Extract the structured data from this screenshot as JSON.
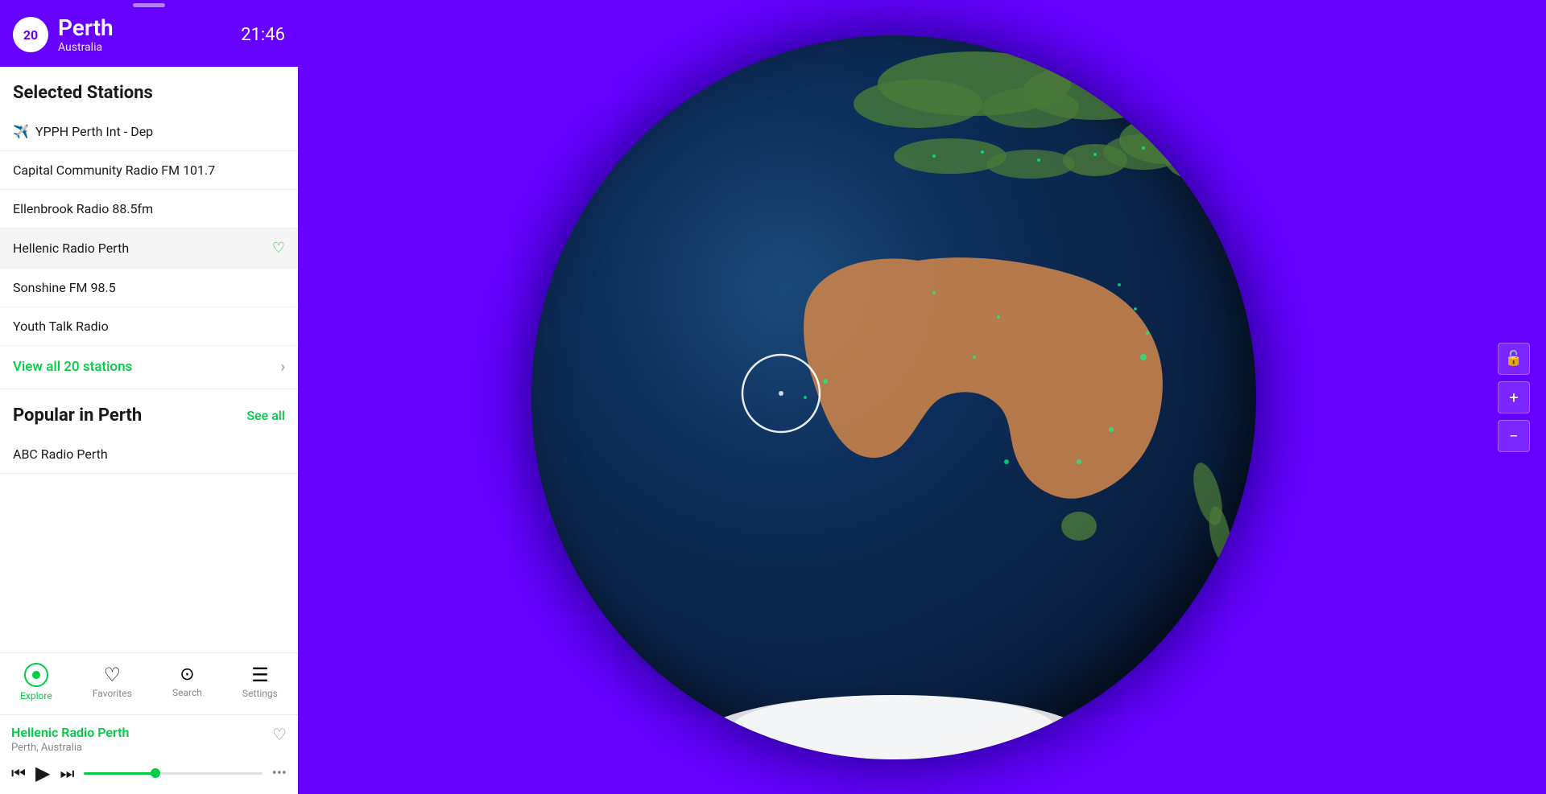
{
  "header": {
    "badge_number": "20",
    "city": "Perth",
    "country": "Australia",
    "time": "21:46"
  },
  "selected_stations": {
    "title": "Selected Stations",
    "items": [
      {
        "name": "YPPH Perth Int - Dep",
        "icon": "✈️",
        "highlighted": false
      },
      {
        "name": "Capital Community Radio FM 101.7",
        "icon": "",
        "highlighted": false
      },
      {
        "name": "Ellenbrook Radio 88.5fm",
        "icon": "",
        "highlighted": false
      },
      {
        "name": "Hellenic Radio Perth",
        "icon": "",
        "highlighted": true,
        "favorited": true
      },
      {
        "name": "Sonshine FM 98.5",
        "icon": "",
        "highlighted": false
      },
      {
        "name": "Youth Talk Radio",
        "icon": "",
        "highlighted": false
      }
    ],
    "view_all_label": "View all 20 stations"
  },
  "popular": {
    "title": "Popular in Perth",
    "see_all_label": "See all",
    "items": [
      {
        "name": "ABC Radio Perth"
      }
    ]
  },
  "nav": {
    "items": [
      {
        "label": "Explore",
        "icon": "circle",
        "active": true
      },
      {
        "label": "Favorites",
        "icon": "♡",
        "active": false
      },
      {
        "label": "Search",
        "icon": "⌕",
        "active": false
      },
      {
        "label": "Settings",
        "icon": "☰",
        "active": false
      }
    ]
  },
  "now_playing": {
    "title": "Hellenic Radio Perth",
    "subtitle": "Perth, Australia",
    "progress": 40
  },
  "map_controls": {
    "lock_icon": "🔓",
    "plus_icon": "+",
    "minus_icon": "−"
  }
}
